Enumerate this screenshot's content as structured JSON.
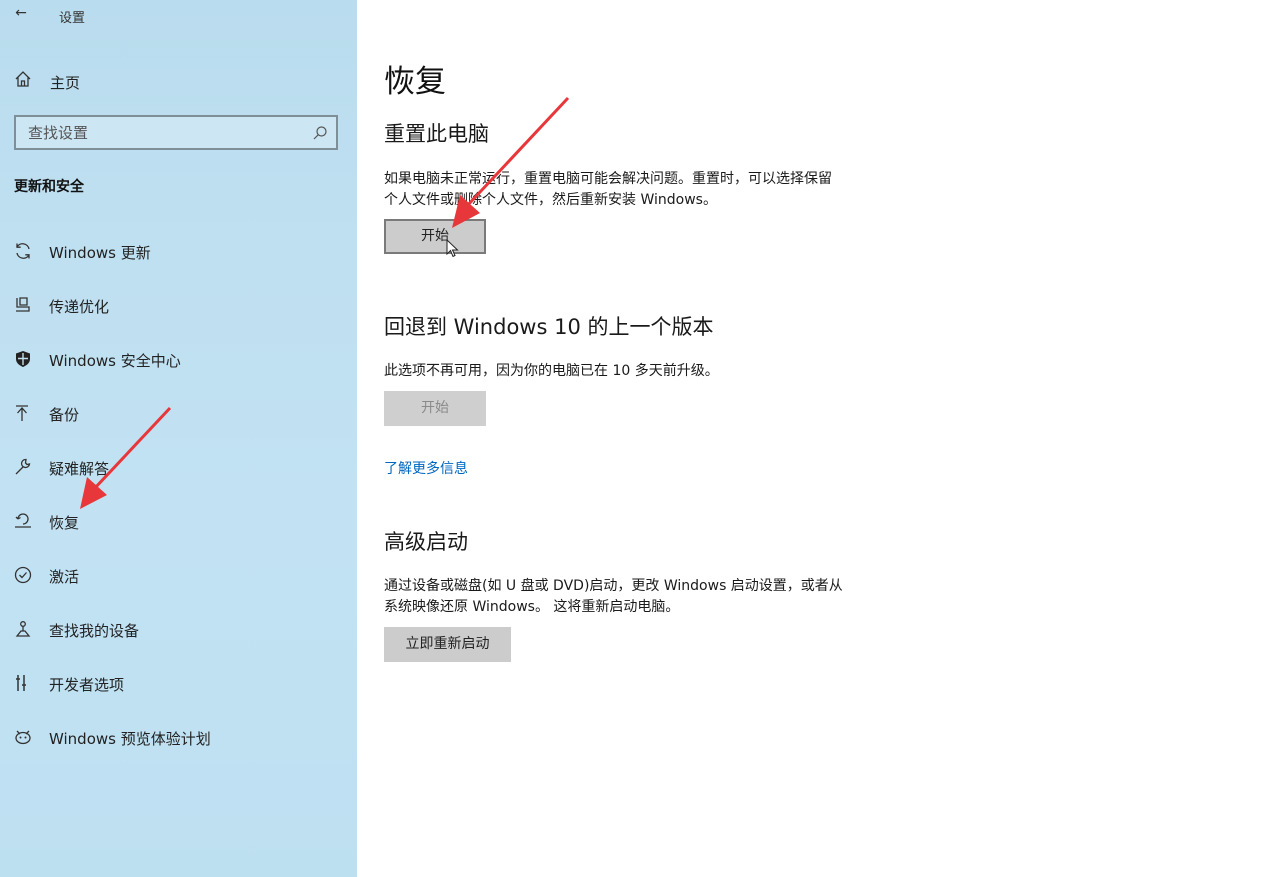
{
  "titlebar": {
    "title": "设置",
    "back_icon": "back-arrow-icon"
  },
  "sidebar": {
    "home_label": "主页",
    "search_placeholder": "查找设置",
    "section_title": "更新和安全",
    "items": [
      {
        "label": "Windows 更新",
        "icon": "sync-icon"
      },
      {
        "label": "传递优化",
        "icon": "delivery-optimization-icon"
      },
      {
        "label": "Windows 安全中心",
        "icon": "shield-icon"
      },
      {
        "label": "备份",
        "icon": "backup-arrow-icon"
      },
      {
        "label": "疑难解答",
        "icon": "wrench-icon"
      },
      {
        "label": "恢复",
        "icon": "recovery-icon"
      },
      {
        "label": "激活",
        "icon": "check-circle-icon"
      },
      {
        "label": "查找我的设备",
        "icon": "find-device-icon"
      },
      {
        "label": "开发者选项",
        "icon": "developer-icon"
      },
      {
        "label": "Windows 预览体验计划",
        "icon": "insider-icon"
      }
    ]
  },
  "main": {
    "title": "恢复",
    "reset": {
      "heading": "重置此电脑",
      "desc_line1": "如果电脑未正常运行，重置电脑可能会解决问题。重置时，可以选择保留",
      "desc_line2": "个人文件或删除个人文件，然后重新安装 Windows。",
      "button": "开始"
    },
    "rollback": {
      "heading": "回退到 Windows 10 的上一个版本",
      "desc": "此选项不再可用，因为你的电脑已在 10 多天前升级。",
      "button": "开始"
    },
    "learn_more": "了解更多信息",
    "advanced": {
      "heading": "高级启动",
      "desc_line1": "通过设备或磁盘(如 U 盘或 DVD)启动，更改 Windows 启动设置，或者从",
      "desc_line2": "系统映像还原 Windows。 这将重新启动电脑。",
      "button": "立即重新启动"
    }
  },
  "annotation_color": "#e8373a"
}
